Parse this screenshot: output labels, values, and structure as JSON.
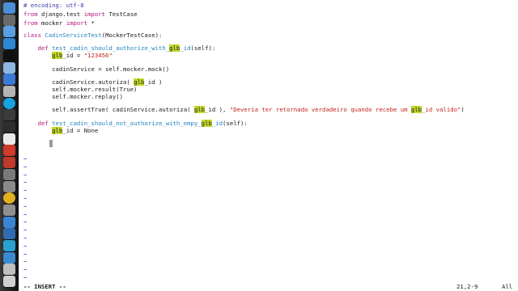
{
  "dock": {
    "icons": [
      {
        "name": "finder-icon",
        "color": "#4a8fd8"
      },
      {
        "name": "dashboard-icon",
        "color": "#6b6b6b"
      },
      {
        "name": "compass-icon",
        "color": "#5aa0e0"
      },
      {
        "name": "app-store-icon",
        "color": "#2e86d6"
      },
      {
        "name": "terminal-icon",
        "color": "#111111"
      },
      {
        "name": "text-editor-icon",
        "color": "#8fb8e0"
      },
      {
        "name": "photos-icon",
        "color": "#3a7bd5"
      },
      {
        "name": "music-icon",
        "color": "#b5b5b5"
      },
      {
        "name": "skype-icon",
        "color": "#17a3e0"
      },
      {
        "name": "video-icon",
        "color": "#3c3c3c"
      },
      {
        "name": "facetime-icon",
        "color": "#2d2d2d"
      },
      {
        "name": "calendar-icon",
        "color": "#e9e9e9"
      },
      {
        "name": "ical-icon",
        "color": "#d23a2a"
      },
      {
        "name": "tools-icon",
        "color": "#c0392b"
      },
      {
        "name": "photo-icon",
        "color": "#7a7a7a"
      },
      {
        "name": "preferences-icon",
        "color": "#8a8a8a"
      },
      {
        "name": "chrome-icon",
        "color": "#e0b020"
      },
      {
        "name": "gear-icon",
        "color": "#909090"
      },
      {
        "name": "xcode-icon",
        "color": "#3b86d4"
      },
      {
        "name": "monitor-icon",
        "color": "#2f6db0"
      },
      {
        "name": "network-icon",
        "color": "#2aa0d0"
      },
      {
        "name": "keychain-icon",
        "color": "#3a8ad0"
      },
      {
        "name": "folder-icon",
        "color": "#bfbfbf"
      },
      {
        "name": "trash-icon",
        "color": "#d0d0d0"
      }
    ]
  },
  "code": {
    "line1": "# encoding: utf-8",
    "l2_from": "from",
    "l2_mod": " django.test ",
    "l2_import": "import",
    "l2_name": " TestCase",
    "l3_from": "from",
    "l3_mod": " mocker ",
    "l3_import": "import",
    "l3_star": " *",
    "l5_class": "class",
    "l5_sp": " ",
    "l5_name": "CadinServiceTest",
    "l5_rest": "(MockerTestCase):",
    "l7_indent": "    ",
    "l7_def": "def",
    "l7_fn1": " test_cadin_should_authorize_with_",
    "l7_glb": "glb",
    "l7_fn2": "_id",
    "l7_rest": "(self):",
    "l8_indent": "        ",
    "l8_glb": "glb",
    "l8_mid": "_id = ",
    "l8_str": "\"123456\"",
    "l10": "        cadinService = self.mocker.mock()",
    "l12_pre": "        cadinService.autoriza( ",
    "l12_glb": "glb",
    "l12_post": "_id )",
    "l13": "        self.mocker.result(True)",
    "l14": "        self.mocker.replay()",
    "l16_pre": "        self.assertTrue( cadinService.autoriza( ",
    "l16_glb": "glb",
    "l16_mid": "_id ), ",
    "l16_str1": "\"Deveria ter retornado verdadeiro quando recebe um ",
    "l16_glb2": "glb",
    "l16_str2": "_id valido\"",
    "l16_end": ")",
    "l18_indent": "    ",
    "l18_def": "def",
    "l18_fn1": " test_cadin_should_not_authorize_with_empy_",
    "l18_glb": "glb",
    "l18_fn2": "_id",
    "l18_rest": "(self):",
    "l19_indent": "        ",
    "l19_glb": "glb",
    "l19_rest": "_id = None",
    "tilde": "~"
  },
  "statusbar": {
    "mode": "-- INSERT --",
    "position": "21,2-9",
    "scroll": "All"
  }
}
